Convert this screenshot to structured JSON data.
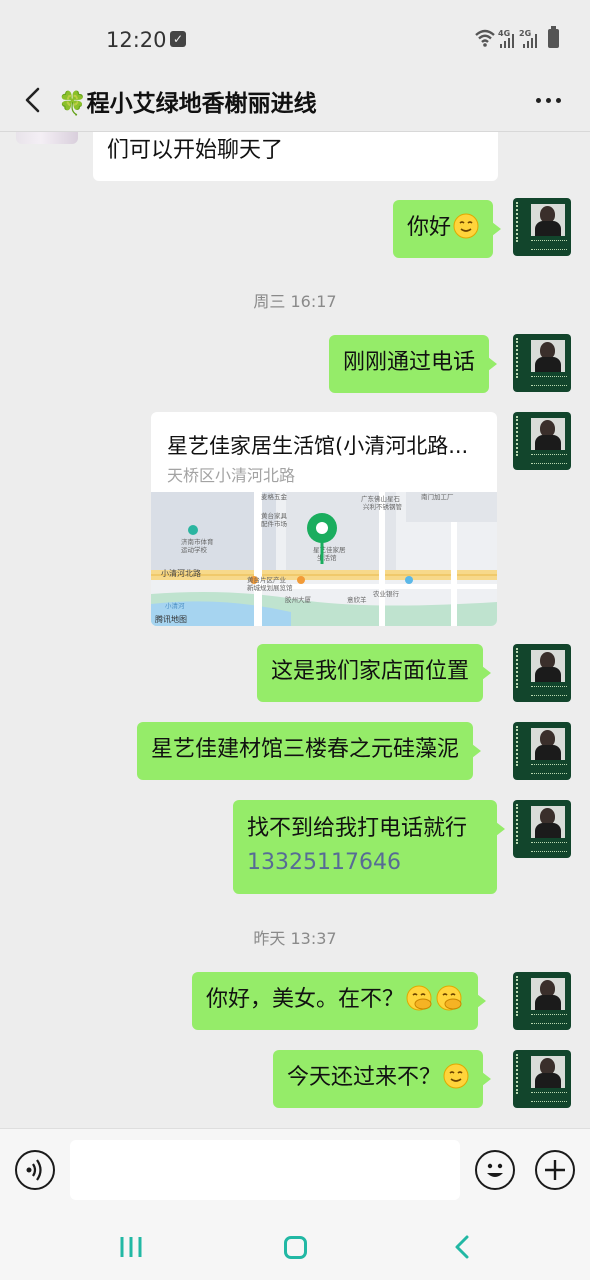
{
  "status_bar": {
    "time": "12:20",
    "network_1": "4G",
    "network_2": "2G"
  },
  "header": {
    "back_icon": "chevron-left-icon",
    "title": "🍀程小艾绿地香榭丽进线",
    "more_icon": "more-dots-icon"
  },
  "messages": {
    "m0": {
      "side": "left",
      "text": "们可以开始聊天了"
    },
    "m1": {
      "side": "right",
      "text": "你好",
      "emoji": "smile-emoji"
    },
    "t1": "周三 16:17",
    "m2": {
      "side": "right",
      "text": "刚刚通过电话"
    },
    "m3": {
      "side": "right",
      "type": "location",
      "title": "星艺佳家居生活馆(小清河北路...",
      "address": "天桥区小清河北路",
      "map": {
        "poi_1": "麦格五金",
        "poi_2": "广东佛山星石",
        "poi_3": "南门加工厂",
        "poi_4": "兴利不锈钢管",
        "poi_5": "黄台家具",
        "poi_6": "配件市场",
        "poi_7": "济南市体育",
        "poi_8": "运动学校",
        "poi_9": "星艺佳家居",
        "poi_10": "生活馆",
        "road": "小清河北路",
        "poi_11": "黄台片区产业",
        "poi_12": "新城规划展览馆",
        "poi_13": "农业银行",
        "poi_14": "胶州大厦",
        "poi_15": "意欣羊",
        "river": "小清河",
        "attribution": "腾讯地图"
      }
    },
    "m4": {
      "side": "right",
      "text": "这是我们家店面位置"
    },
    "m5": {
      "side": "right",
      "text": "星艺佳建材馆三楼春之元硅藻泥"
    },
    "m6": {
      "side": "right",
      "text": "找不到给我打电话就行",
      "phone": "13325117646"
    },
    "t2": "昨天 13:37",
    "m7": {
      "side": "right",
      "text": "你好，美女。在不？",
      "emoji": "hand-over-mouth-emoji"
    },
    "m8": {
      "side": "right",
      "text": "今天还过来不？",
      "emoji": "smile-emoji"
    }
  },
  "input_bar": {
    "voice_icon": "voice-icon",
    "emoji_icon": "emoji-icon",
    "plus_icon": "plus-icon",
    "input_value": ""
  },
  "nav_bar": {
    "recents_icon": "recents-icon",
    "home_icon": "home-icon",
    "back_icon": "back-icon"
  },
  "colors": {
    "sent_bubble": "#95ec69",
    "received_bubble": "#ffffff",
    "background": "#ededed",
    "phone_link": "#576b95",
    "map_pin": "#1aad5e",
    "nav_accent": "#22b8a4"
  }
}
